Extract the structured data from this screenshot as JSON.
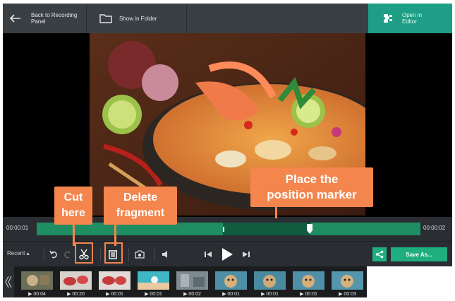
{
  "toolbar": {
    "back_label": "Back to Recording Panel",
    "show_folder_label": "Show in Folder",
    "open_editor_label": "Open in Editor",
    "editor_color": "#1e9e86"
  },
  "timeline": {
    "start_time": "00:00:01",
    "end_time": "00:00:02",
    "track_color": "#1f8e62",
    "selection_color": "#115c41"
  },
  "controls": {
    "recent_label": "Recent ▴",
    "save_label": "Save As...",
    "accent_color": "#1fae7e",
    "icons": [
      "undo-icon",
      "redo-icon",
      "scissors-icon",
      "delete-icon",
      "camera-icon",
      "volume-icon",
      "previous-icon",
      "play-icon",
      "next-icon",
      "share-icon"
    ]
  },
  "filmstrip": {
    "items": [
      {
        "duration": "00:04"
      },
      {
        "duration": "00:20"
      },
      {
        "duration": "00:01"
      },
      {
        "duration": "00:01"
      },
      {
        "duration": "00:02"
      },
      {
        "duration": "00:01"
      },
      {
        "duration": "00:01"
      },
      {
        "duration": "00:01"
      },
      {
        "duration": "00:03"
      }
    ]
  },
  "callouts": {
    "cut_line1": "Cut",
    "cut_line2": "here",
    "delete_line1": "Delete",
    "delete_line2": "fragment",
    "place_line1": "Place the",
    "place_line2": "position marker",
    "color": "#f3854d"
  }
}
